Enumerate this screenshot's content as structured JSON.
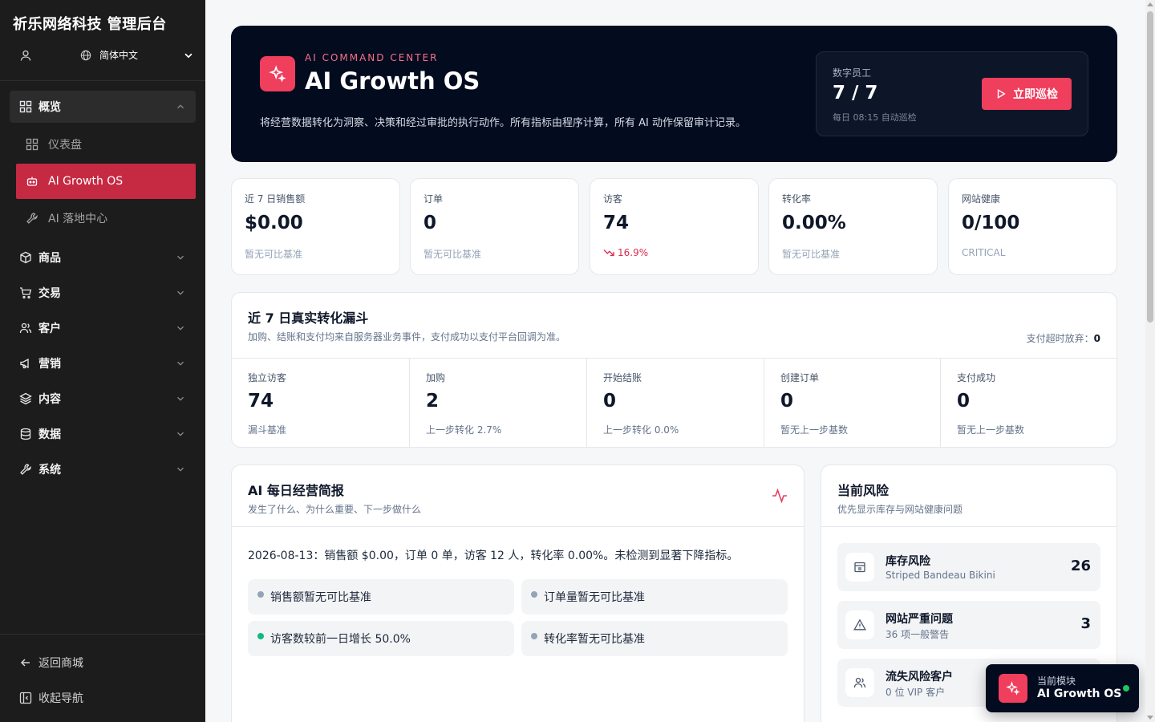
{
  "brand": "祈乐网络科技 管理后台",
  "language": "简体中文",
  "nav": {
    "overview": "概览",
    "dashboard": "仪表盘",
    "ai_growth": "AI Growth OS",
    "ai_landing": "AI 落地中心",
    "products": "商品",
    "trade": "交易",
    "customers": "客户",
    "marketing": "营销",
    "content": "内容",
    "data": "数据",
    "system": "系统",
    "back_to_store": "返回商城",
    "collapse_nav": "收起导航"
  },
  "hero": {
    "kicker": "AI COMMAND CENTER",
    "title": "AI Growth OS",
    "description": "将经营数据转化为洞察、决策和经过审批的执行动作。所有指标由程序计算，所有 AI 动作保留审计记录。",
    "box_label": "数字员工",
    "box_value": "7 / 7",
    "box_sub": "每日 08:15 自动巡检",
    "button": "立即巡检"
  },
  "kpis": [
    {
      "label": "近 7 日销售额",
      "value": "$0.00",
      "note": "暂无可比基准"
    },
    {
      "label": "订单",
      "value": "0",
      "note": "暂无可比基准"
    },
    {
      "label": "访客",
      "value": "74",
      "note": "16.9%"
    },
    {
      "label": "转化率",
      "value": "0.00%",
      "note": "暂无可比基准"
    },
    {
      "label": "网站健康",
      "value": "0/100",
      "note": "CRITICAL"
    }
  ],
  "funnel": {
    "title": "近 7 日真实转化漏斗",
    "subtitle": "加购、结账和支付均来自服务器业务事件，支付成功以支付平台回调为准。",
    "timeout_label": "支付超时放弃：",
    "timeout_value": "0",
    "steps": [
      {
        "label": "独立访客",
        "value": "74",
        "note": "漏斗基准"
      },
      {
        "label": "加购",
        "value": "2",
        "note": "上一步转化 2.7%"
      },
      {
        "label": "开始结账",
        "value": "0",
        "note": "上一步转化 0.0%"
      },
      {
        "label": "创建订单",
        "value": "0",
        "note": "暂无上一步基数"
      },
      {
        "label": "支付成功",
        "value": "0",
        "note": "暂无上一步基数"
      }
    ]
  },
  "report": {
    "title": "AI 每日经营简报",
    "subtitle": "发生了什么、为什么重要、下一步做什么",
    "body": "2026-08-13：销售额 $0.00，订单 0 单，访客 12 人，转化率 0.00%。未检测到显著下降指标。",
    "items": [
      {
        "text": "销售额暂无可比基准",
        "color": "#94a3b8"
      },
      {
        "text": "订单量暂无可比基准",
        "color": "#94a3b8"
      },
      {
        "text": "访客数较前一日增长 50.0%",
        "color": "#10b981"
      },
      {
        "text": "转化率暂无可比基准",
        "color": "#94a3b8"
      }
    ]
  },
  "risk": {
    "title": "当前风险",
    "subtitle": "优先显示库存与网站健康问题",
    "items": [
      {
        "title": "库存风险",
        "sub": "Striped Bandeau Bikini",
        "count": "26",
        "icon": "archive-icon"
      },
      {
        "title": "网站严重问题",
        "sub": "36 项一般警告",
        "count": "3",
        "icon": "warning-icon"
      },
      {
        "title": "流失风险客户",
        "sub": "0 位 VIP 客户",
        "count": "",
        "icon": "users-icon"
      }
    ]
  },
  "floater": {
    "label": "当前模块",
    "value": "AI Growth OS"
  },
  "colors": {
    "accent": "#f03e5d",
    "active_nav": "#c52a42",
    "hero_bg": "#030b1f",
    "sidebar_bg": "#1c1c1c"
  }
}
